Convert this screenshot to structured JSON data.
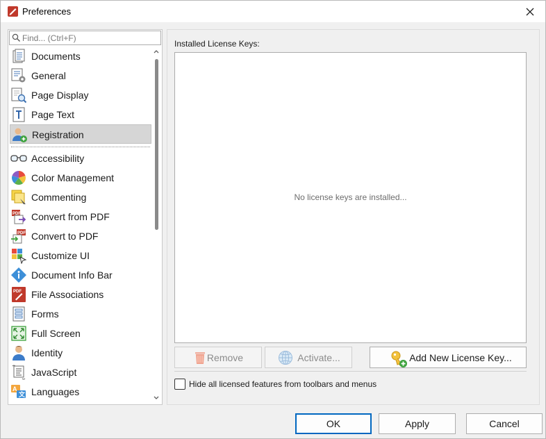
{
  "window": {
    "title": "Preferences"
  },
  "search": {
    "placeholder": "Find... (Ctrl+F)"
  },
  "nav": {
    "items": [
      {
        "label": "Documents",
        "icon": "documents-icon"
      },
      {
        "label": "General",
        "icon": "general-settings-icon"
      },
      {
        "label": "Page Display",
        "icon": "page-display-icon"
      },
      {
        "label": "Page Text",
        "icon": "page-text-icon"
      },
      {
        "label": "Registration",
        "icon": "registration-icon",
        "selected": true
      },
      {
        "label": "Accessibility",
        "icon": "glasses-icon"
      },
      {
        "label": "Color Management",
        "icon": "color-wheel-icon"
      },
      {
        "label": "Commenting",
        "icon": "commenting-icon"
      },
      {
        "label": "Convert from PDF",
        "icon": "convert-from-pdf-icon"
      },
      {
        "label": "Convert to PDF",
        "icon": "convert-to-pdf-icon"
      },
      {
        "label": "Customize UI",
        "icon": "customize-ui-icon"
      },
      {
        "label": "Document Info Bar",
        "icon": "info-icon"
      },
      {
        "label": "File Associations",
        "icon": "pdf-file-icon"
      },
      {
        "label": "Forms",
        "icon": "forms-icon"
      },
      {
        "label": "Full Screen",
        "icon": "full-screen-icon"
      },
      {
        "label": "Identity",
        "icon": "identity-icon"
      },
      {
        "label": "JavaScript",
        "icon": "javascript-icon"
      },
      {
        "label": "Languages",
        "icon": "languages-icon"
      }
    ]
  },
  "license": {
    "section_label": "Installed License Keys:",
    "empty_message": "No license keys are installed...",
    "remove_label": "Remove",
    "activate_label": "Activate...",
    "add_label": "Add New License Key...",
    "hide_label": "Hide all licensed features from toolbars and menus",
    "hide_checked": false
  },
  "footer": {
    "ok_label": "OK",
    "apply_label": "Apply",
    "cancel_label": "Cancel"
  },
  "colors": {
    "accent": "#0067c0",
    "selected_bg": "#d6d6d6",
    "window_bg": "#f0f0f0"
  }
}
